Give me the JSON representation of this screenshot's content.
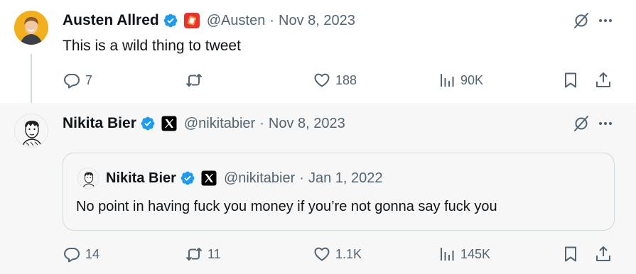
{
  "tweets": [
    {
      "author_name": "Austen Allred",
      "handle": "@Austen",
      "separator": "·",
      "date": "Nov 8, 2023",
      "text": "This is a wild thing to tweet",
      "affiliate_icon": "orange-affiliate-logo-icon",
      "metrics": {
        "replies": "7",
        "reposts": "",
        "likes": "188",
        "views": "90K"
      }
    },
    {
      "author_name": "Nikita Bier",
      "handle": "@nikitabier",
      "separator": "·",
      "date": "Nov 8, 2023",
      "affiliate_icon": "x-logo-icon",
      "quote": {
        "author_name": "Nikita Bier",
        "handle": "@nikitabier",
        "separator": "·",
        "date": "Jan 1, 2022",
        "text": "No point in having fuck you money if you’re not gonna say fuck you"
      },
      "metrics": {
        "replies": "14",
        "reposts": "11",
        "likes": "1.1K",
        "views": "145K"
      }
    }
  ],
  "colors": {
    "text": "#0f1419",
    "secondary": "#536471",
    "verified": "#1d9bf0",
    "border": "#cfd9de"
  }
}
